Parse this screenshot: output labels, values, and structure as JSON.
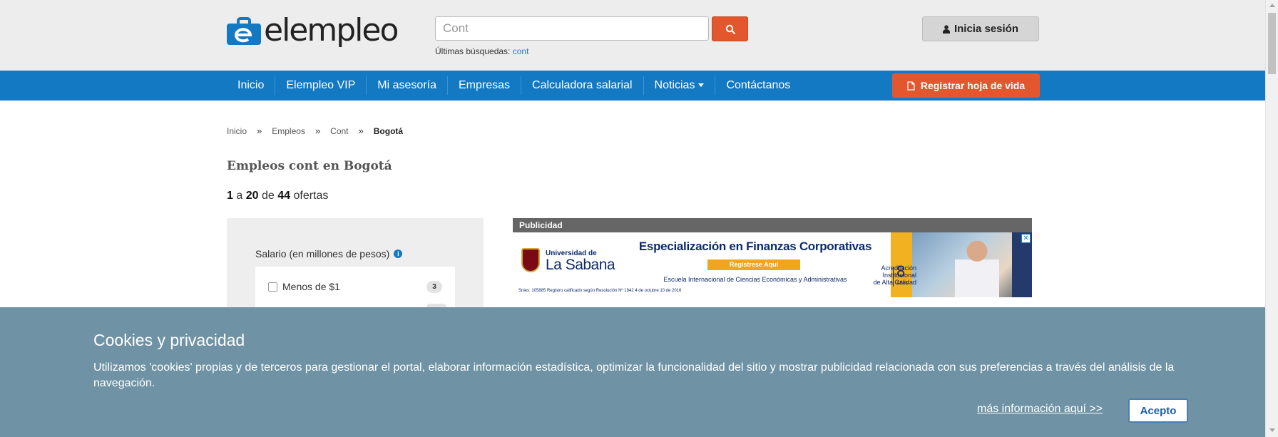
{
  "header": {
    "logo_text": "elempleo",
    "search": {
      "value": "Cont",
      "placeholder": ""
    },
    "recent_label": "Últimas búsquedas:",
    "recent_link": "cont",
    "login_label": "Inicia sesión"
  },
  "nav": {
    "items": [
      {
        "label": "Inicio"
      },
      {
        "label": "Elempleo VIP"
      },
      {
        "label": "Mi asesoría"
      },
      {
        "label": "Empresas"
      },
      {
        "label": "Calculadora salarial"
      },
      {
        "label": "Noticias"
      },
      {
        "label": "Contáctanos"
      }
    ],
    "register_label": "Registrar hoja de vida"
  },
  "breadcrumb": {
    "items": [
      "Inicio",
      "Empleos",
      "Cont"
    ],
    "separator": "»",
    "current": "Bogotá"
  },
  "main": {
    "title": "Empleos cont en Bogotá",
    "results": {
      "from": "1",
      "from_to": "a",
      "to": "20",
      "of": "de",
      "total": "44",
      "suffix": "ofertas"
    }
  },
  "filters": {
    "salary_title": "Salario (en millones de pesos)",
    "info_glyph": "i",
    "option_label": "Menos de $1",
    "option_count": "3"
  },
  "ad": {
    "label": "Publicidad",
    "close_glyph": "✕",
    "university_prefix": "Universidad de",
    "university_name": "La Sabana",
    "headline": "Especialización en Finanzas Corporativas",
    "cta": "Regístrese Aquí",
    "school": "Escuela Internacional de Ciencias Económicas y Administrativas",
    "accreditation_line1": "Acreditación",
    "accreditation_line2": "Institucional",
    "accreditation_line3": "de Alta Calidad",
    "accreditation_years": "8",
    "accreditation_years_label": "Años",
    "fine_print": "Snies: 105885 Registro calificado según Resolución Nº 1942 4 de octubre 10 de 2016"
  },
  "cookies": {
    "title": "Cookies y privacidad",
    "text": "Utilizamos 'cookies' propias y de terceros para gestionar el portal, elaborar información estadística, optimizar la funcionalidad del sitio y mostrar publicidad relacionada con sus preferencias a través del análisis de la navegación.",
    "more_link": "más información aquí >>",
    "accept_label": "Acepto"
  },
  "colors": {
    "brand_blue": "#1379c2",
    "accent_orange": "#e4572e",
    "cookie_bg": "#6f93a5"
  },
  "icons": {
    "search_button": "search-icon",
    "login": "user-icon",
    "register": "file-icon",
    "filter_info": "info-icon"
  }
}
